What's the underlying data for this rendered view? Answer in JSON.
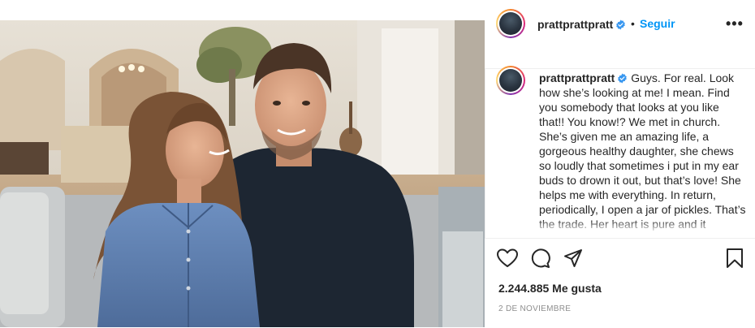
{
  "header": {
    "username": "prattprattpratt",
    "separator": "•",
    "follow_label": "Seguir",
    "more_label": "•••"
  },
  "caption": {
    "username": "prattprattpratt",
    "text": "Guys. For real. Look how she’s looking at me! I mean. Find you somebody that looks at you like that!! You know!? We met in church. She’s given me an amazing life, a gorgeous healthy daughter, she chews so loudly that sometimes i put in my ear buds to drown it out, but that’s love! She helps me with everything. In return, periodically, I open a jar of pickles. That’s the trade. Her heart is pure and it"
  },
  "actions": {
    "likes": "2.244.885 Me gusta",
    "date": "2 DE NOVIEMBRE"
  },
  "icons": [
    "verified-badge-icon",
    "heart-icon",
    "comment-icon",
    "share-icon",
    "bookmark-icon",
    "more-options-icon"
  ],
  "colors": {
    "follow_blue": "#0095f6",
    "verified_blue": "#3897f0",
    "text": "#262626",
    "muted": "#8e8e8e"
  }
}
